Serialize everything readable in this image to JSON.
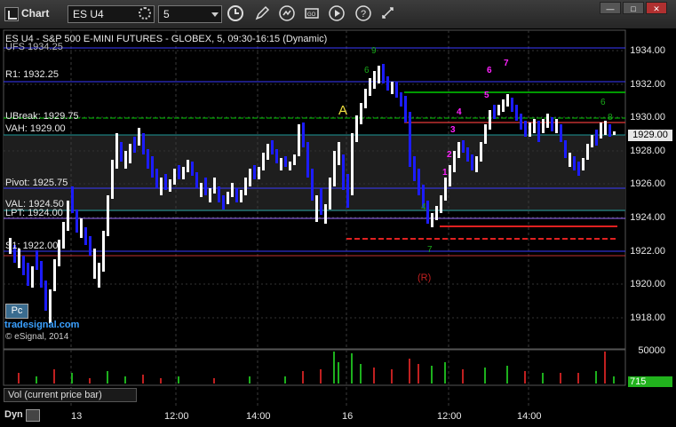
{
  "window": {
    "title": "Chart",
    "symbol": "ES U4",
    "interval": "5"
  },
  "chart_header": "ES U4 - S&P 500 E-MINI FUTURES - GLOBEX, 5, 09:30-16:15 (Dynamic)",
  "levels": {
    "ufs": "UFS 1934.25",
    "r1": "R1: 1932.25",
    "ubreak": "UBreak: 1929.75",
    "vah": "VAH: 1929.00",
    "pivot": "Pivot: 1925.75",
    "val": "VAL: 1924.50",
    "lpt": "LPT: 1924.00",
    "s1": "S1: 1922.00"
  },
  "price_axis": [
    "1934.00",
    "1932.00",
    "1930.00",
    "1928.00",
    "1926.00",
    "1924.00",
    "1922.00",
    "1920.00",
    "1918.00"
  ],
  "current_price": "1929.00",
  "volume_axis": "50000",
  "volume_value": "715",
  "volume_label": "Vol (current price bar)",
  "time_axis": [
    "13",
    "12:00",
    "14:00",
    "16",
    "12:00",
    "14:00"
  ],
  "annotations": {
    "a_marker": "A",
    "r_marker": "(R)"
  },
  "pc_button": "Pc",
  "brand": "tradesignal.com",
  "copyright": "© eSignal, 2014",
  "dyn_label": "Dyn",
  "colors": {
    "background": "#000000",
    "up_bar": "#ffffff",
    "down_bar": "#1c1cff",
    "level_blue": "#3a3aff",
    "level_green": "#00b000",
    "level_red": "#e02020",
    "magenta": "#ff22ff",
    "value_area": "#1e1e1e"
  }
}
